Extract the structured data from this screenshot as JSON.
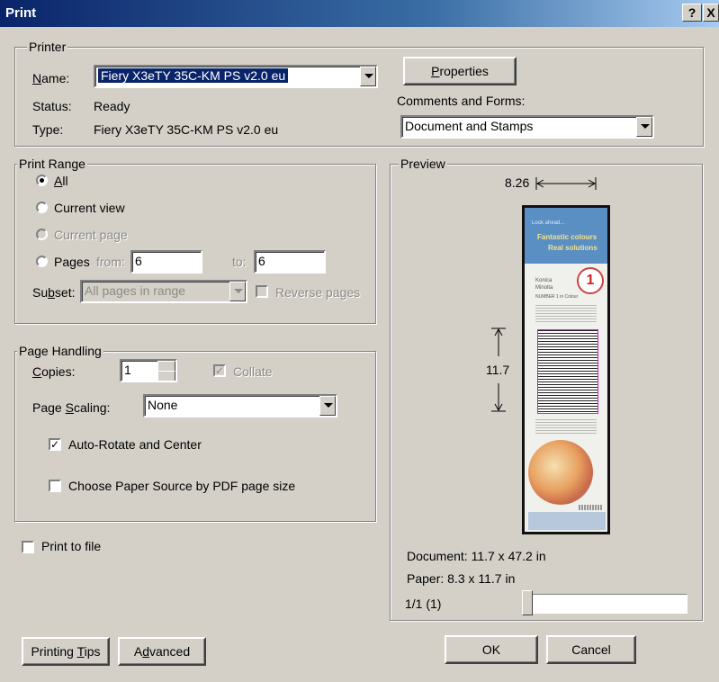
{
  "window": {
    "title": "Print",
    "help": "?",
    "close": "X"
  },
  "printer": {
    "group_label": "Printer",
    "name_label": "Name:",
    "name_value": "Fiery X3eTY 35C-KM PS v2.0 eu",
    "status_label": "Status:",
    "status_value": "Ready",
    "type_label": "Type:",
    "type_value": "Fiery X3eTY 35C-KM PS v2.0 eu",
    "properties_button": "Properties",
    "comments_label": "Comments and Forms:",
    "comments_value": "Document and Stamps"
  },
  "print_range": {
    "group_label": "Print Range",
    "all": "All",
    "current_view": "Current view",
    "current_page": "Current page",
    "pages": "Pages",
    "from_label": "from:",
    "from_value": "6",
    "to_label": "to:",
    "to_value": "6",
    "subset_label": "Subset:",
    "subset_value": "All pages in range",
    "reverse_pages": "Reverse pages",
    "selected": "all"
  },
  "page_handling": {
    "group_label": "Page Handling",
    "copies_label": "Copies:",
    "copies_value": "1",
    "collate": "Collate",
    "scaling_label": "Page Scaling:",
    "scaling_value": "None",
    "auto_rotate": "Auto-Rotate and Center",
    "auto_rotate_checked": true,
    "paper_source": "Choose Paper Source by PDF page size",
    "paper_source_checked": false
  },
  "print_to_file": {
    "label": "Print to file",
    "checked": false
  },
  "preview": {
    "group_label": "Preview",
    "width_label": "8.26",
    "height_label": "11.7",
    "document_size": "Document: 11.7 x 47.2 in",
    "paper_size": "Paper: 8.3 x 11.7 in",
    "page_counter": "1/1 (1)",
    "thumbnail": {
      "line1": "Look ahead...",
      "line2": "Fantastic colours",
      "line3": "Real solutions",
      "badge": "1",
      "brand1": "Konica",
      "brand2": "Minolta",
      "brand3": "NUMBER 1 in Colour"
    }
  },
  "buttons": {
    "printing_tips": "Printing Tips",
    "advanced": "Advanced",
    "ok": "OK",
    "cancel": "Cancel"
  }
}
